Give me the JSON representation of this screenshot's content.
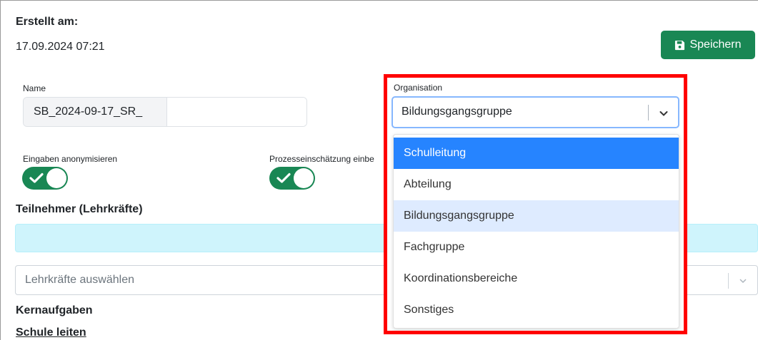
{
  "created": {
    "label": "Erstellt am:",
    "value": "17.09.2024 07:21"
  },
  "toolbar": {
    "save_label": "Speichern"
  },
  "name_field": {
    "label": "Name",
    "prefix": "SB_2024-09-17_SR_",
    "value": ""
  },
  "toggles": {
    "anonymize_label": "Eingaben anonymisieren",
    "process_label": "Prozesseinschätzung einbe"
  },
  "participants": {
    "title": "Teilnehmer (Lehrkräfte)",
    "placeholder": "Lehrkräfte auswählen"
  },
  "core_tasks": {
    "title": "Kernaufgaben",
    "first_link": "Schule leiten"
  },
  "organisation": {
    "label": "Organisation",
    "selected": "Bildungsgangsgruppe",
    "options": [
      "Schulleitung",
      "Abteilung",
      "Bildungsgangsgruppe",
      "Fachgruppe",
      "Koordinationsbereiche",
      "Sonstiges"
    ]
  },
  "colors": {
    "success": "#198754",
    "option_hover": "#2684ff",
    "option_selected": "#deebff",
    "highlight": "#ff0000",
    "info": "#cff4fc"
  },
  "icons": {
    "save": "floppy-disk-icon",
    "toggle": "check-icon",
    "dropdown": "chevron-down-icon"
  }
}
